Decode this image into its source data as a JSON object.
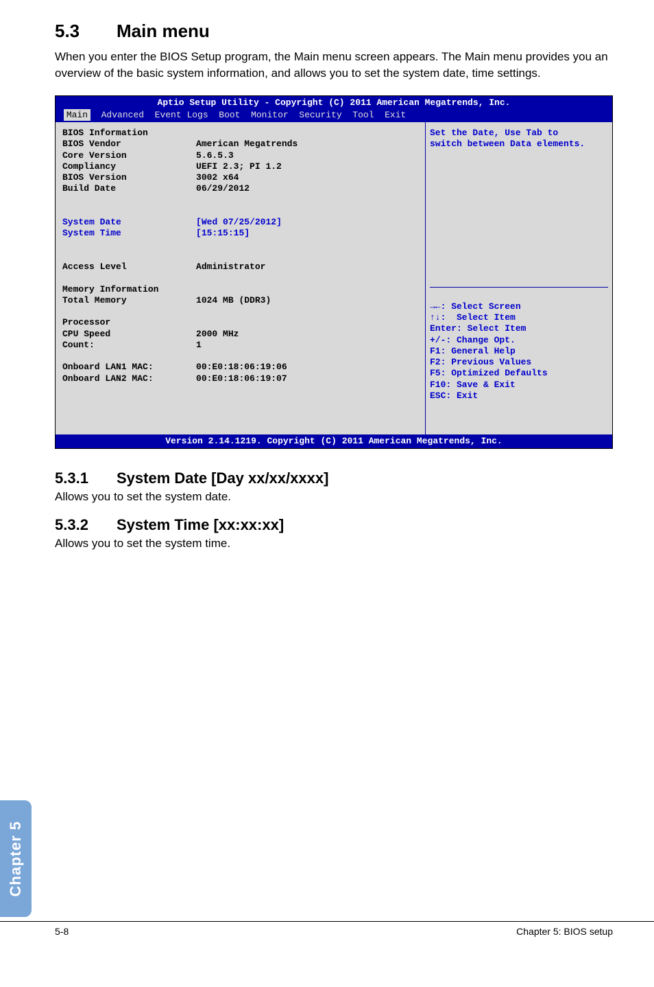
{
  "header": {
    "section_number": "5.3",
    "section_title": "Main menu",
    "intro": "When you enter the BIOS Setup program, the Main menu screen appears. The Main menu provides you an overview of the basic system information, and allows you to set the system date, time settings."
  },
  "bios": {
    "titlebar": "Aptio Setup Utility - Copyright (C) 2011 American Megatrends, Inc.",
    "menu_active": "Main",
    "menu_rest": "  Advanced  Event Logs  Boot  Monitor  Security  Tool  Exit",
    "left": {
      "l01": "BIOS Information",
      "l02": "BIOS Vendor              American Megatrends",
      "l03": "Core Version             5.6.5.3",
      "l04": "Compliancy               UEFI 2.3; PI 1.2",
      "l05": "BIOS Version             3002 x64",
      "l06": "Build Date               06/29/2012",
      "l07": "",
      "l08": "",
      "l09a": "System Date",
      "l09b": "              [Wed 07/25/2012]",
      "l10a": "System Time",
      "l10b": "              [15:15:15]",
      "l11": "",
      "l12": "",
      "l13": "Access Level             Administrator",
      "l14": "",
      "l15": "Memory Information",
      "l16": "Total Memory             1024 MB (DDR3)",
      "l17": "",
      "l18": "Processor",
      "l19": "CPU Speed                2000 MHz",
      "l20": "Count:                   1",
      "l21": "",
      "l22": "Onboard LAN1 MAC:        00:E0:18:06:19:06",
      "l23": "Onboard LAN2 MAC:        00:E0:18:06:19:07",
      "pad": "\n\n\n\n\n"
    },
    "right": {
      "help1": "Set the Date, Use Tab to",
      "help2": "switch between Data elements.",
      "nav1": "→←: Select Screen",
      "nav2": "↑↓:  Select Item",
      "nav3": "Enter: Select Item",
      "nav4": "+/-: Change Opt.",
      "nav5": "F1: General Help",
      "nav6": "F2: Previous Values",
      "nav7": "F5: Optimized Defaults",
      "nav8": "F10: Save & Exit",
      "nav9": "ESC: Exit"
    },
    "footer": "Version 2.14.1219. Copyright (C) 2011 American Megatrends, Inc."
  },
  "sub1": {
    "num": "5.3.1",
    "title": "System Date [Day xx/xx/xxxx]",
    "text": "Allows you to set the system date."
  },
  "sub2": {
    "num": "5.3.2",
    "title": "System Time [xx:xx:xx]",
    "text": "Allows you to set the system time."
  },
  "sidetab": "Chapter 5",
  "footer": {
    "left": "5-8",
    "right": "Chapter 5: BIOS setup"
  }
}
